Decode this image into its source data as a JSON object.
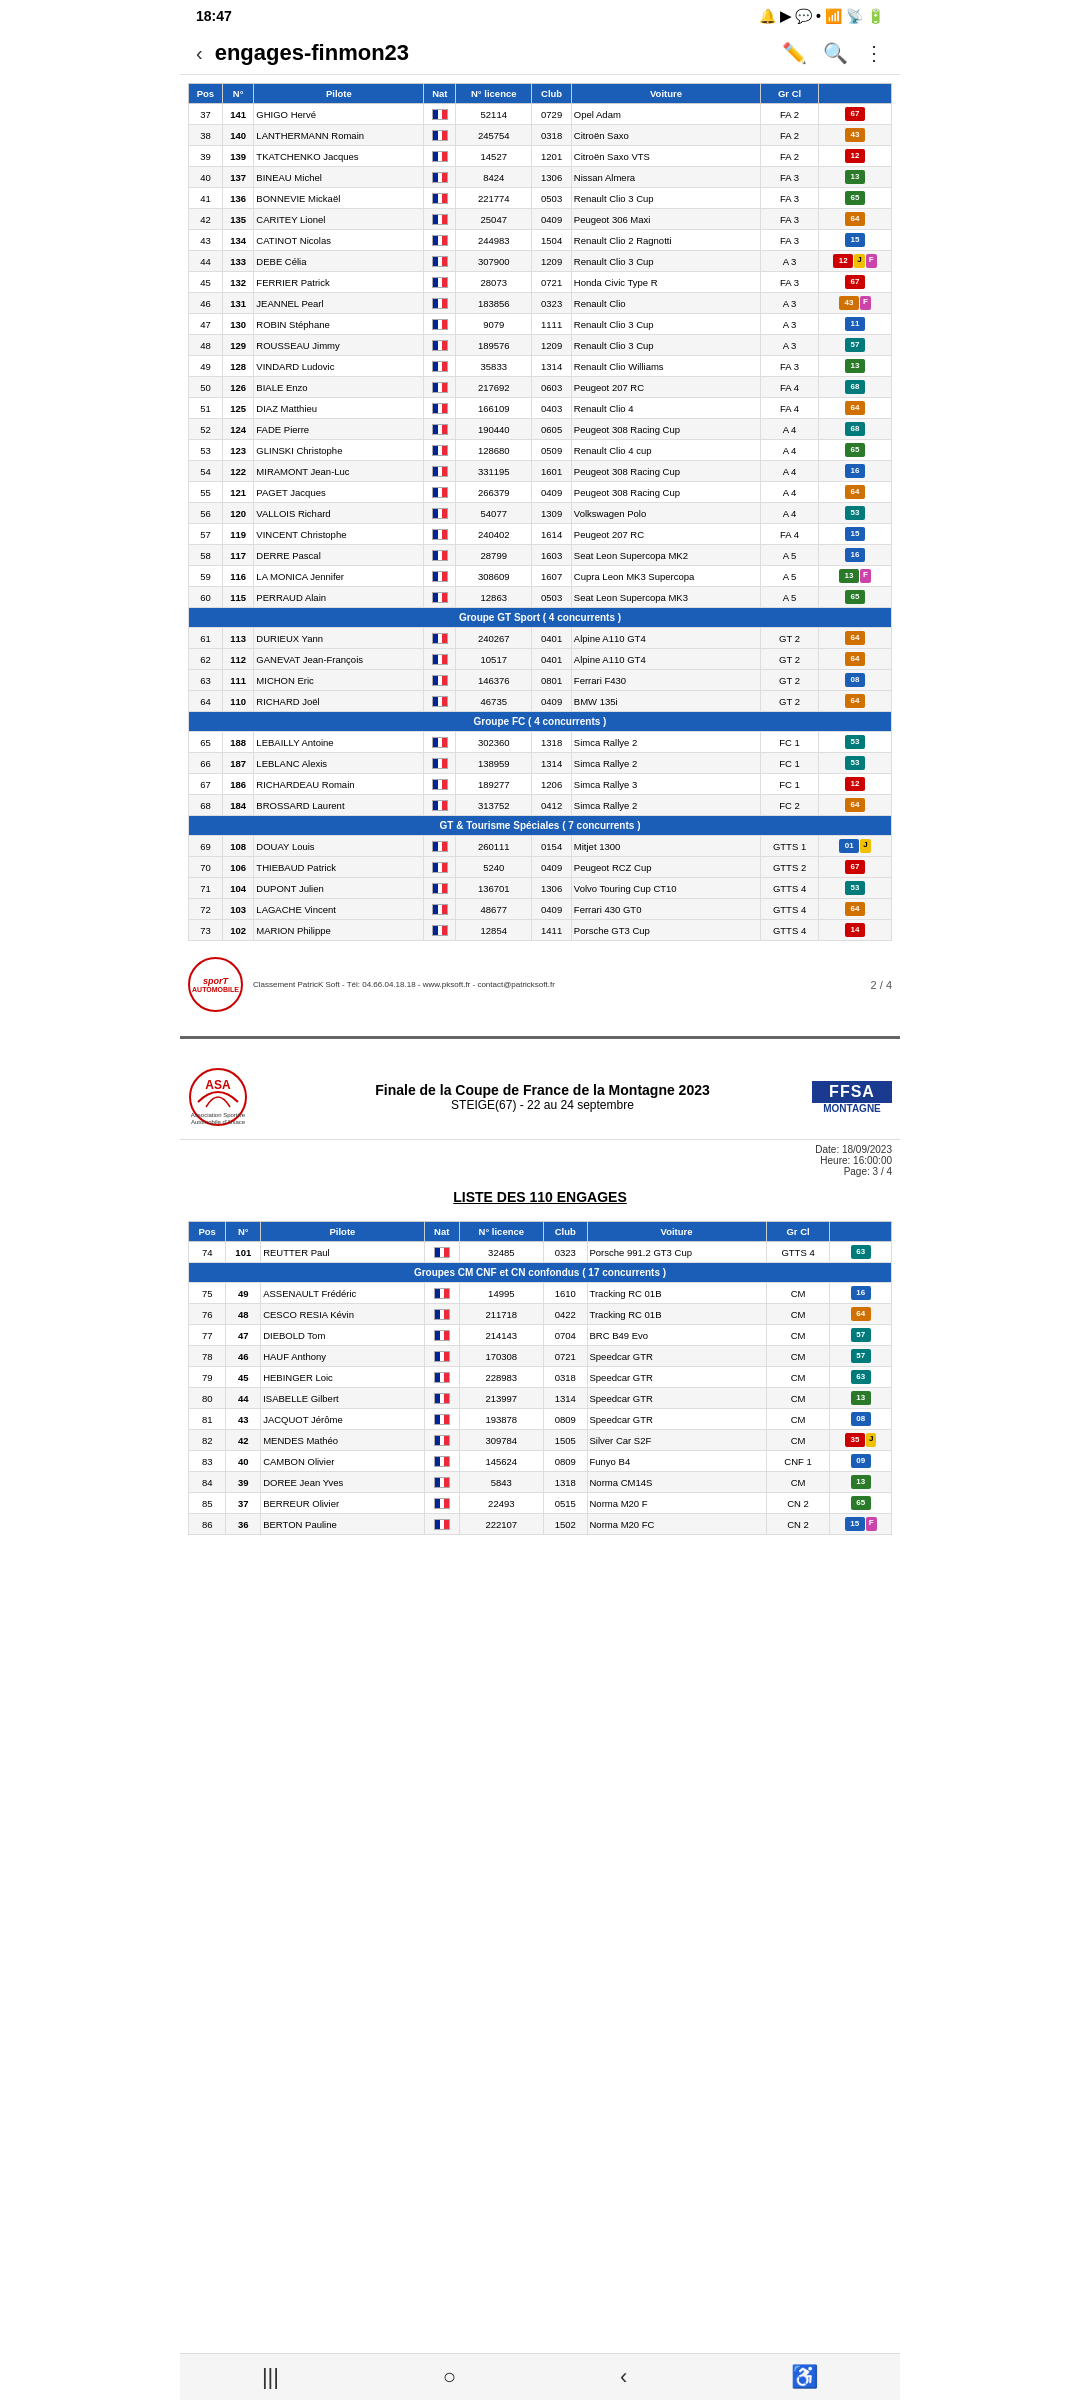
{
  "statusBar": {
    "time": "18:47",
    "icons": [
      "notification",
      "youtube",
      "messenger",
      "dot",
      "wifi",
      "signal",
      "battery"
    ]
  },
  "browserBar": {
    "title": "engages-finmon23",
    "icons": [
      "edit",
      "search",
      "more"
    ]
  },
  "page2": {
    "tableHeaders": [
      "Pos",
      "N°",
      "Pilote",
      "Nat",
      "N° licence",
      "Club",
      "Voiture",
      "Gr Cl",
      ""
    ],
    "rows": [
      {
        "pos": "37",
        "num": "141",
        "pilote": "GHIGO Hervé",
        "licence": "52114",
        "club": "0729",
        "voiture": "Opel Adam",
        "grCl": "FA 2",
        "badge": "67",
        "badgeColor": "badge-red"
      },
      {
        "pos": "38",
        "num": "140",
        "pilote": "LANTHERMANN Romain",
        "licence": "245754",
        "club": "0318",
        "voiture": "Citroën Saxo",
        "grCl": "FA 2",
        "badge": "43",
        "badgeColor": "badge-orange"
      },
      {
        "pos": "39",
        "num": "139",
        "pilote": "TKATCHENKO Jacques",
        "licence": "14527",
        "club": "1201",
        "voiture": "Citroën Saxo VTS",
        "grCl": "FA 2",
        "badge": "12",
        "badgeColor": "badge-red"
      },
      {
        "pos": "40",
        "num": "137",
        "pilote": "BINEAU Michel",
        "licence": "8424",
        "club": "1306",
        "voiture": "Nissan Almera",
        "grCl": "FA 3",
        "badge": "13",
        "badgeColor": "badge-green"
      },
      {
        "pos": "41",
        "num": "136",
        "pilote": "BONNEVIE Mickaël",
        "licence": "221774",
        "club": "0503",
        "voiture": "Renault Clio 3 Cup",
        "grCl": "FA 3",
        "badge": "65",
        "badgeColor": "badge-green"
      },
      {
        "pos": "42",
        "num": "135",
        "pilote": "CARITEY Lionel",
        "licence": "25047",
        "club": "0409",
        "voiture": "Peugeot 306 Maxi",
        "grCl": "FA 3",
        "badge": "64",
        "badgeColor": "badge-orange"
      },
      {
        "pos": "43",
        "num": "134",
        "pilote": "CATINOT Nicolas",
        "licence": "244983",
        "club": "1504",
        "voiture": "Renault Clio 2 Ragnotti",
        "grCl": "FA 3",
        "badge": "15",
        "badgeColor": "badge-blue"
      },
      {
        "pos": "44",
        "num": "133",
        "pilote": "DEBE Célia",
        "licence": "307900",
        "club": "1209",
        "voiture": "Renault Clio 3 Cup",
        "grCl": "A 3",
        "badge": "12",
        "badgeColor": "badge-red",
        "extra": [
          "J",
          "F"
        ]
      },
      {
        "pos": "45",
        "num": "132",
        "pilote": "FERRIER Patrick",
        "licence": "28073",
        "club": "0721",
        "voiture": "Honda Civic Type R",
        "grCl": "FA 3",
        "badge": "67",
        "badgeColor": "badge-red"
      },
      {
        "pos": "46",
        "num": "131",
        "pilote": "JEANNEL Pearl",
        "licence": "183856",
        "club": "0323",
        "voiture": "Renault Clio",
        "grCl": "A 3",
        "badge": "43",
        "badgeColor": "badge-orange",
        "extra": [
          "F"
        ]
      },
      {
        "pos": "47",
        "num": "130",
        "pilote": "ROBIN Stéphane",
        "licence": "9079",
        "club": "1111",
        "voiture": "Renault Clio 3 Cup",
        "grCl": "A 3",
        "badge": "11",
        "badgeColor": "badge-blue"
      },
      {
        "pos": "48",
        "num": "129",
        "pilote": "ROUSSEAU Jimmy",
        "licence": "189576",
        "club": "1209",
        "voiture": "Renault Clio 3 Cup",
        "grCl": "A 3",
        "badge": "57",
        "badgeColor": "badge-teal"
      },
      {
        "pos": "49",
        "num": "128",
        "pilote": "VINDARD Ludovic",
        "licence": "35833",
        "club": "1314",
        "voiture": "Renault Clio Williams",
        "grCl": "FA 3",
        "badge": "13",
        "badgeColor": "badge-green"
      },
      {
        "pos": "50",
        "num": "126",
        "pilote": "BIALE Enzo",
        "licence": "217692",
        "club": "0603",
        "voiture": "Peugeot 207 RC",
        "grCl": "FA 4",
        "badge": "68",
        "badgeColor": "badge-teal"
      },
      {
        "pos": "51",
        "num": "125",
        "pilote": "DIAZ Matthieu",
        "licence": "166109",
        "club": "0403",
        "voiture": "Renault Clio 4",
        "grCl": "FA 4",
        "badge": "64",
        "badgeColor": "badge-orange"
      },
      {
        "pos": "52",
        "num": "124",
        "pilote": "FADE Pierre",
        "licence": "190440",
        "club": "0605",
        "voiture": "Peugeot 308 Racing Cup",
        "grCl": "A 4",
        "badge": "68",
        "badgeColor": "badge-teal"
      },
      {
        "pos": "53",
        "num": "123",
        "pilote": "GLINSKI Christophe",
        "licence": "128680",
        "club": "0509",
        "voiture": "Renault Clio 4 cup",
        "grCl": "A 4",
        "badge": "65",
        "badgeColor": "badge-green"
      },
      {
        "pos": "54",
        "num": "122",
        "pilote": "MIRAMONT Jean-Luc",
        "licence": "331195",
        "club": "1601",
        "voiture": "Peugeot 308 Racing Cup",
        "grCl": "A 4",
        "badge": "16",
        "badgeColor": "badge-blue"
      },
      {
        "pos": "55",
        "num": "121",
        "pilote": "PAGET Jacques",
        "licence": "266379",
        "club": "0409",
        "voiture": "Peugeot 308 Racing Cup",
        "grCl": "A 4",
        "badge": "64",
        "badgeColor": "badge-orange"
      },
      {
        "pos": "56",
        "num": "120",
        "pilote": "VALLOIS Richard",
        "licence": "54077",
        "club": "1309",
        "voiture": "Volkswagen Polo",
        "grCl": "A 4",
        "badge": "53",
        "badgeColor": "badge-teal"
      },
      {
        "pos": "57",
        "num": "119",
        "pilote": "VINCENT Christophe",
        "licence": "240402",
        "club": "1614",
        "voiture": "Peugeot 207 RC",
        "grCl": "FA 4",
        "badge": "15",
        "badgeColor": "badge-blue"
      },
      {
        "pos": "58",
        "num": "117",
        "pilote": "DERRE Pascal",
        "licence": "28799",
        "club": "1603",
        "voiture": "Seat Leon Supercopa MK2",
        "grCl": "A 5",
        "badge": "16",
        "badgeColor": "badge-blue"
      },
      {
        "pos": "59",
        "num": "116",
        "pilote": "LA MONICA Jennifer",
        "licence": "308609",
        "club": "1607",
        "voiture": "Cupra Leon MK3 Supercopa",
        "grCl": "A 5",
        "badge": "13",
        "badgeColor": "badge-green",
        "extra": [
          "F"
        ]
      },
      {
        "pos": "60",
        "num": "115",
        "pilote": "PERRAUD Alain",
        "licence": "12863",
        "club": "0503",
        "voiture": "Seat Leon Supercopa MK3",
        "grCl": "A 5",
        "badge": "65",
        "badgeColor": "badge-green"
      }
    ],
    "group1": {
      "label": "Groupe GT Sport ( 4 concurrents )",
      "rows": [
        {
          "pos": "61",
          "num": "113",
          "pilote": "DURIEUX Yann",
          "licence": "240267",
          "club": "0401",
          "voiture": "Alpine A110 GT4",
          "grCl": "GT 2",
          "badge": "64",
          "badgeColor": "badge-orange"
        },
        {
          "pos": "62",
          "num": "112",
          "pilote": "GANEVAT Jean-François",
          "licence": "10517",
          "club": "0401",
          "voiture": "Alpine A110 GT4",
          "grCl": "GT 2",
          "badge": "64",
          "badgeColor": "badge-orange"
        },
        {
          "pos": "63",
          "num": "111",
          "pilote": "MICHON Eric",
          "licence": "146376",
          "club": "0801",
          "voiture": "Ferrari F430",
          "grCl": "GT 2",
          "badge": "08",
          "badgeColor": "badge-blue"
        },
        {
          "pos": "64",
          "num": "110",
          "pilote": "RICHARD Joël",
          "licence": "46735",
          "club": "0409",
          "voiture": "BMW 135i",
          "grCl": "GT 2",
          "badge": "64",
          "badgeColor": "badge-orange"
        }
      ]
    },
    "group2": {
      "label": "Groupe FC ( 4 concurrents )",
      "rows": [
        {
          "pos": "65",
          "num": "188",
          "pilote": "LEBAILLY Antoine",
          "licence": "302360",
          "club": "1318",
          "voiture": "Simca Rallye 2",
          "grCl": "FC 1",
          "badge": "53",
          "badgeColor": "badge-teal"
        },
        {
          "pos": "66",
          "num": "187",
          "pilote": "LEBLANC Alexis",
          "licence": "138959",
          "club": "1314",
          "voiture": "Simca Rallye 2",
          "grCl": "FC 1",
          "badge": "53",
          "badgeColor": "badge-teal"
        },
        {
          "pos": "67",
          "num": "186",
          "pilote": "RICHARDEAU Romain",
          "licence": "189277",
          "club": "1206",
          "voiture": "Simca Rallye 3",
          "grCl": "FC 1",
          "badge": "12",
          "badgeColor": "badge-red"
        },
        {
          "pos": "68",
          "num": "184",
          "pilote": "BROSSARD Laurent",
          "licence": "313752",
          "club": "0412",
          "voiture": "Simca Rallye 2",
          "grCl": "FC 2",
          "badge": "64",
          "badgeColor": "badge-orange"
        }
      ]
    },
    "group3": {
      "label": "GT & Tourisme Spéciales ( 7 concurrents )",
      "rows": [
        {
          "pos": "69",
          "num": "108",
          "pilote": "DOUAY Louis",
          "licence": "260111",
          "club": "0154",
          "voiture": "Mitjet 1300",
          "grCl": "GTTS 1",
          "badge": "01",
          "badgeColor": "badge-blue",
          "extra": [
            "J"
          ]
        },
        {
          "pos": "70",
          "num": "106",
          "pilote": "THIEBAUD Patrick",
          "licence": "5240",
          "club": "0409",
          "voiture": "Peugeot RCZ Cup",
          "grCl": "GTTS 2",
          "badge": "67",
          "badgeColor": "badge-red"
        },
        {
          "pos": "71",
          "num": "104",
          "pilote": "DUPONT Julien",
          "licence": "136701",
          "club": "1306",
          "voiture": "Volvo Touring Cup CT10",
          "grCl": "GTTS 4",
          "badge": "53",
          "badgeColor": "badge-teal"
        },
        {
          "pos": "72",
          "num": "103",
          "pilote": "LAGACHE Vincent",
          "licence": "48677",
          "club": "0409",
          "voiture": "Ferrari 430 GT0",
          "grCl": "GTTS 4",
          "badge": "64",
          "badgeColor": "badge-orange"
        },
        {
          "pos": "73",
          "num": "102",
          "pilote": "MARION Philippe",
          "licence": "12854",
          "club": "1411",
          "voiture": "Porsche GT3 Cup",
          "grCl": "GTTS 4",
          "badge": "14",
          "badgeColor": "badge-red"
        }
      ]
    },
    "footer": {
      "logoText1": "sporT",
      "logoText2": "AUTOMOBILE",
      "footerText": "Classement PatricK Soft - Tél: 04.66.04.18.18 - www.pksoft.fr - contact@patricksoft.fr",
      "pageNum": "2 / 4"
    }
  },
  "page3": {
    "asaLogo": "ASA",
    "headerTitle": "Finale de la Coupe de France de la Montagne 2023",
    "headerSubtitle": "STEIGE(67) - 22 au 24 septembre",
    "ffsaText": "FFSA",
    "ffsaSub": "MONTAGNE",
    "dateInfo": {
      "date": "Date: 18/09/2023",
      "heure": "Heure: 16:00:00",
      "page": "Page: 3 / 4"
    },
    "listTitle": "LISTE DES 110 ENGAGES",
    "tableHeaders": [
      "Pos",
      "N°",
      "Pilote",
      "Nat",
      "N° licence",
      "Club",
      "Voiture",
      "Gr Cl",
      ""
    ],
    "row74": {
      "pos": "74",
      "num": "101",
      "pilote": "REUTTER Paul",
      "licence": "32485",
      "club": "0323",
      "voiture": "Porsche 991.2 GT3 Cup",
      "grCl": "GTTS 4",
      "badge": "63",
      "badgeColor": "badge-teal"
    },
    "group4": {
      "label": "Groupes CM CNF et CN confondus ( 17 concurrents )",
      "rows": [
        {
          "pos": "75",
          "num": "49",
          "pilote": "ASSENAULT Frédéric",
          "licence": "14995",
          "club": "1610",
          "voiture": "Tracking RC 01B",
          "grCl": "CM",
          "badge": "16",
          "badgeColor": "badge-blue"
        },
        {
          "pos": "76",
          "num": "48",
          "pilote": "CESCO RESIA Kévin",
          "licence": "211718",
          "club": "0422",
          "voiture": "Tracking RC 01B",
          "grCl": "CM",
          "badge": "64",
          "badgeColor": "badge-orange"
        },
        {
          "pos": "77",
          "num": "47",
          "pilote": "DIEBOLD Tom",
          "licence": "214143",
          "club": "0704",
          "voiture": "BRC B49 Evo",
          "grCl": "CM",
          "badge": "57",
          "badgeColor": "badge-teal"
        },
        {
          "pos": "78",
          "num": "46",
          "pilote": "HAUF Anthony",
          "licence": "170308",
          "club": "0721",
          "voiture": "Speedcar GTR",
          "grCl": "CM",
          "badge": "57",
          "badgeColor": "badge-teal"
        },
        {
          "pos": "79",
          "num": "45",
          "pilote": "HEBINGER Loic",
          "licence": "228983",
          "club": "0318",
          "voiture": "Speedcar GTR",
          "grCl": "CM",
          "badge": "63",
          "badgeColor": "badge-teal"
        },
        {
          "pos": "80",
          "num": "44",
          "pilote": "ISABELLE Gilbert",
          "licence": "213997",
          "club": "1314",
          "voiture": "Speedcar GTR",
          "grCl": "CM",
          "badge": "13",
          "badgeColor": "badge-green"
        },
        {
          "pos": "81",
          "num": "43",
          "pilote": "JACQUOT Jérôme",
          "licence": "193878",
          "club": "0809",
          "voiture": "Speedcar GTR",
          "grCl": "CM",
          "badge": "08",
          "badgeColor": "badge-blue"
        },
        {
          "pos": "82",
          "num": "42",
          "pilote": "MENDES Mathéo",
          "licence": "309784",
          "club": "1505",
          "voiture": "Silver Car S2F",
          "grCl": "CM",
          "badge": "35",
          "badgeColor": "badge-red",
          "extra": [
            "J"
          ]
        },
        {
          "pos": "83",
          "num": "40",
          "pilote": "CAMBON Olivier",
          "licence": "145624",
          "club": "0809",
          "voiture": "Funyo B4",
          "grCl": "CNF 1",
          "badge": "09",
          "badgeColor": "badge-blue"
        },
        {
          "pos": "84",
          "num": "39",
          "pilote": "DOREE Jean Yves",
          "licence": "5843",
          "club": "1318",
          "voiture": "Norma CM14S",
          "grCl": "CM",
          "badge": "13",
          "badgeColor": "badge-green"
        },
        {
          "pos": "85",
          "num": "37",
          "pilote": "BERREUR Olivier",
          "licence": "22493",
          "club": "0515",
          "voiture": "Norma M20 F",
          "grCl": "CN 2",
          "badge": "65",
          "badgeColor": "badge-green"
        },
        {
          "pos": "86",
          "num": "36",
          "pilote": "BERTON Pauline",
          "licence": "222107",
          "club": "1502",
          "voiture": "Norma M20 FC",
          "grCl": "CN 2",
          "badge": "15",
          "badgeColor": "badge-blue",
          "extra": [
            "F"
          ]
        }
      ]
    }
  }
}
